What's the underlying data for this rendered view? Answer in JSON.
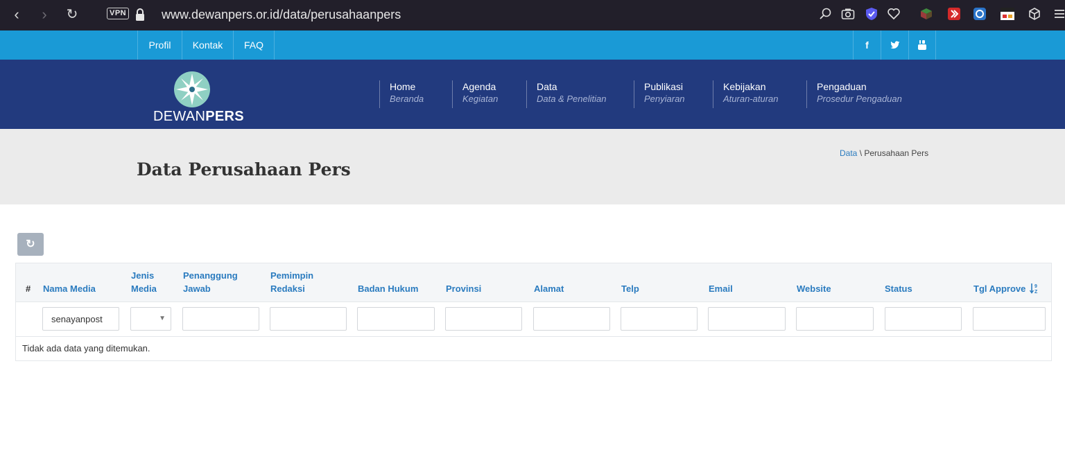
{
  "browser": {
    "vpn_label": "VPN",
    "url": "www.dewanpers.or.id/data/perusahaanpers"
  },
  "topbar": {
    "links": [
      "Profil",
      "Kontak",
      "FAQ"
    ],
    "social": [
      "f",
      "t",
      "yt"
    ]
  },
  "header": {
    "logo_text_light": "DEWAN",
    "logo_text_bold": "PERS",
    "menu": [
      {
        "label": "Home",
        "sub": "Beranda"
      },
      {
        "label": "Agenda",
        "sub": "Kegiatan"
      },
      {
        "label": "Data",
        "sub": "Data & Penelitian"
      },
      {
        "label": "Publikasi",
        "sub": "Penyiaran"
      },
      {
        "label": "Kebijakan",
        "sub": "Aturan-aturan"
      },
      {
        "label": "Pengaduan",
        "sub": "Prosedur Pengaduan"
      }
    ]
  },
  "page": {
    "title": "Data Perusahaan Pers",
    "breadcrumb_link": "Data",
    "breadcrumb_sep": " \\ ",
    "breadcrumb_current": "Perusahaan Pers"
  },
  "grid": {
    "headers": {
      "hash": "#",
      "nama_media": "Nama Media",
      "jenis_media_1": "Jenis",
      "jenis_media_2": "Media",
      "penanggung_1": "Penanggung",
      "penanggung_2": "Jawab",
      "pemimpin_1": "Pemimpin",
      "pemimpin_2": "Redaksi",
      "badan_hukum": "Badan Hukum",
      "provinsi": "Provinsi",
      "alamat": "Alamat",
      "telp": "Telp",
      "email": "Email",
      "website": "Website",
      "status": "Status",
      "tgl_approve": "Tgl Approve"
    },
    "filters": {
      "nama_media": "senayanpost"
    },
    "empty_message": "Tidak ada data yang ditemukan."
  }
}
